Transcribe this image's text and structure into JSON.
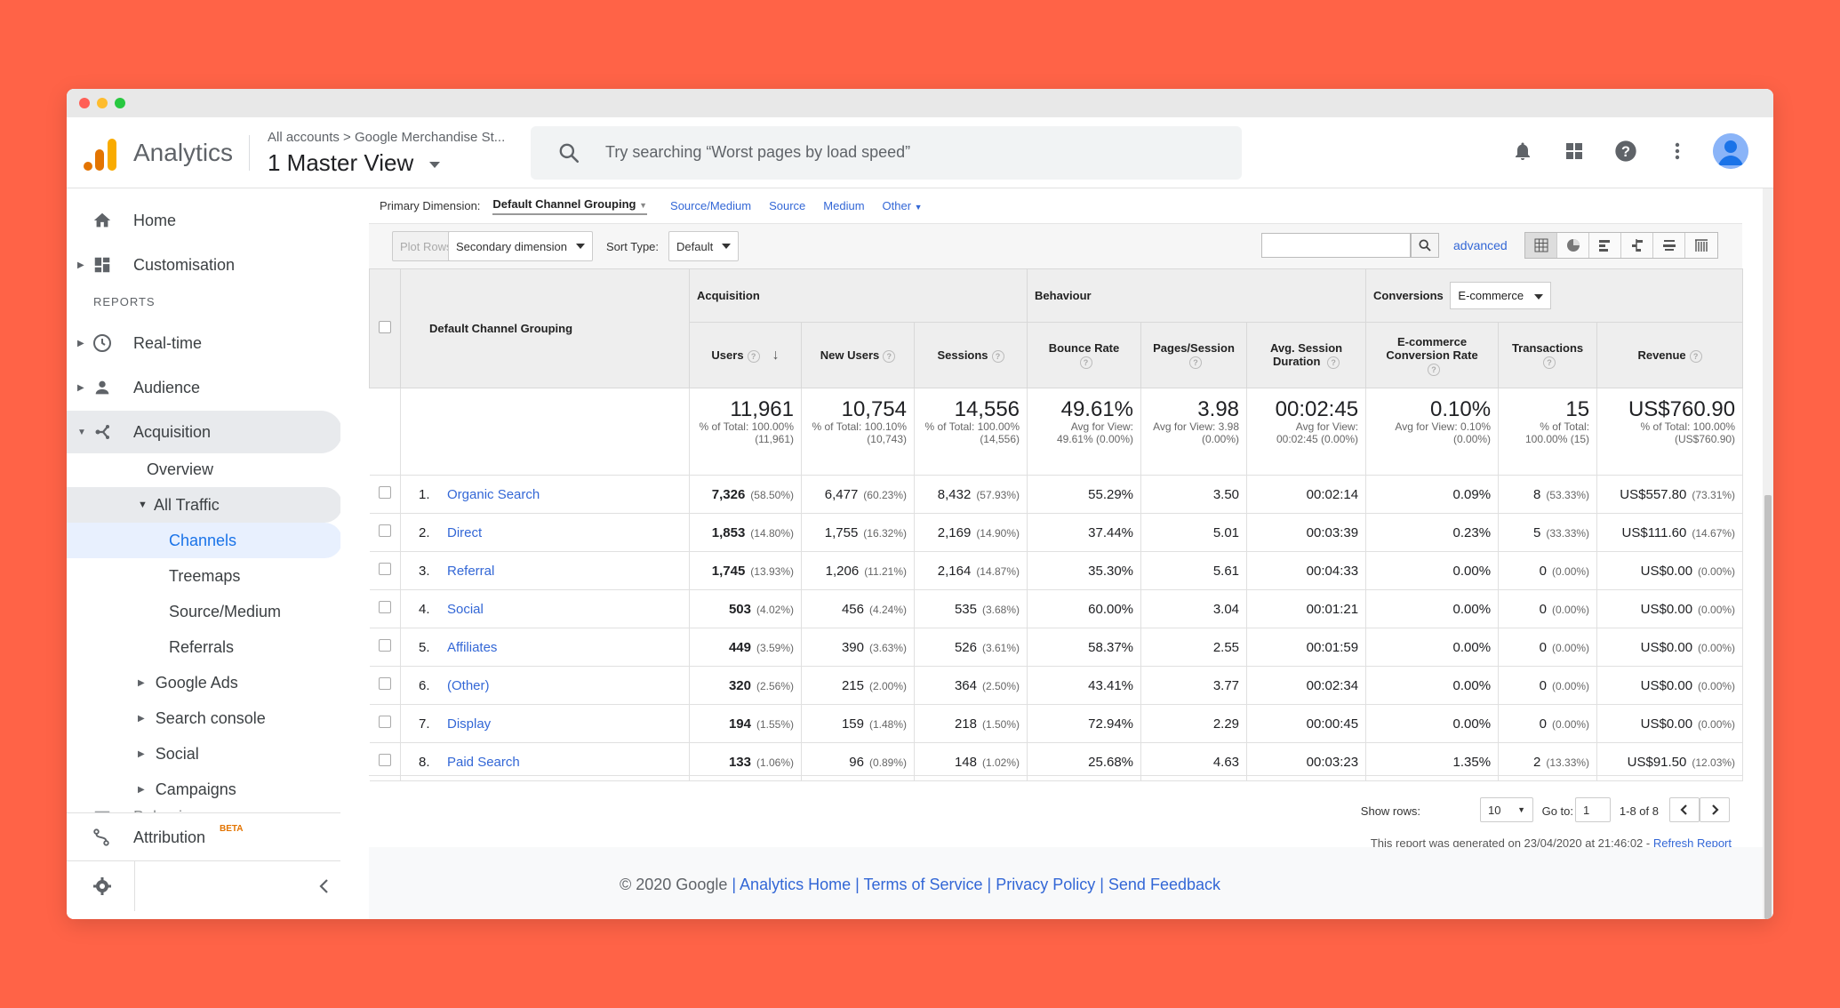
{
  "app": {
    "name": "Analytics"
  },
  "account": {
    "breadcrumb_all": "All accounts",
    "breadcrumb_sep": ">",
    "breadcrumb_property": "Google Merchandise St...",
    "view": "1 Master View"
  },
  "search": {
    "placeholder": "Try searching “Worst pages by load speed”"
  },
  "sidebar": {
    "home": "Home",
    "customisation": "Customisation",
    "reports_heading": "REPORTS",
    "realtime": "Real-time",
    "audience": "Audience",
    "acquisition": "Acquisition",
    "overview": "Overview",
    "all_traffic": "All Traffic",
    "channels": "Channels",
    "treemaps": "Treemaps",
    "source_medium": "Source/Medium",
    "referrals": "Referrals",
    "google_ads": "Google Ads",
    "search_console": "Search console",
    "social": "Social",
    "campaigns": "Campaigns",
    "behaviour": "Behaviour",
    "attribution": "Attribution",
    "beta": "BETA"
  },
  "dimbar": {
    "label": "Primary Dimension:",
    "active": "Default Channel Grouping",
    "options": [
      "Source/Medium",
      "Source",
      "Medium",
      "Other"
    ]
  },
  "toolbar": {
    "plot_rows": "Plot Rows",
    "secondary_dimension": "Secondary dimension",
    "sort_type_label": "Sort Type:",
    "sort_type_value": "Default",
    "advanced": "advanced"
  },
  "table": {
    "dim_header": "Default Channel Grouping",
    "group_acquisition": "Acquisition",
    "group_behaviour": "Behaviour",
    "group_conversions": "Conversions",
    "conversions_select": "E-commerce",
    "columns": [
      "Users",
      "New Users",
      "Sessions",
      "Bounce Rate",
      "Pages/Session",
      "Avg. Session Duration",
      "E-commerce Conversion Rate",
      "Transactions",
      "Revenue"
    ],
    "totals": [
      {
        "big": "11,961",
        "small": "% of Total: 100.00% (11,961)"
      },
      {
        "big": "10,754",
        "small": "% of Total: 100.10% (10,743)"
      },
      {
        "big": "14,556",
        "small": "% of Total: 100.00% (14,556)"
      },
      {
        "big": "49.61%",
        "small": "Avg for View: 49.61% (0.00%)"
      },
      {
        "big": "3.98",
        "small": "Avg for View: 3.98 (0.00%)"
      },
      {
        "big": "00:02:45",
        "small": "Avg for View: 00:02:45 (0.00%)"
      },
      {
        "big": "0.10%",
        "small": "Avg for View: 0.10% (0.00%)"
      },
      {
        "big": "15",
        "small": "% of Total: 100.00% (15)"
      },
      {
        "big": "US$760.90",
        "small": "% of Total: 100.00% (US$760.90)"
      }
    ],
    "rows": [
      {
        "n": "1.",
        "name": "Organic Search",
        "users": "7,326",
        "users_pct": "(58.50%)",
        "new": "6,477",
        "new_pct": "(60.23%)",
        "sess": "8,432",
        "sess_pct": "(57.93%)",
        "bounce": "55.29%",
        "pps": "3.50",
        "dur": "00:02:14",
        "conv": "0.09%",
        "tx": "8",
        "tx_pct": "(53.33%)",
        "rev": "US$557.80",
        "rev_pct": "(73.31%)"
      },
      {
        "n": "2.",
        "name": "Direct",
        "users": "1,853",
        "users_pct": "(14.80%)",
        "new": "1,755",
        "new_pct": "(16.32%)",
        "sess": "2,169",
        "sess_pct": "(14.90%)",
        "bounce": "37.44%",
        "pps": "5.01",
        "dur": "00:03:39",
        "conv": "0.23%",
        "tx": "5",
        "tx_pct": "(33.33%)",
        "rev": "US$111.60",
        "rev_pct": "(14.67%)"
      },
      {
        "n": "3.",
        "name": "Referral",
        "users": "1,745",
        "users_pct": "(13.93%)",
        "new": "1,206",
        "new_pct": "(11.21%)",
        "sess": "2,164",
        "sess_pct": "(14.87%)",
        "bounce": "35.30%",
        "pps": "5.61",
        "dur": "00:04:33",
        "conv": "0.00%",
        "tx": "0",
        "tx_pct": "(0.00%)",
        "rev": "US$0.00",
        "rev_pct": "(0.00%)"
      },
      {
        "n": "4.",
        "name": "Social",
        "users": "503",
        "users_pct": "(4.02%)",
        "new": "456",
        "new_pct": "(4.24%)",
        "sess": "535",
        "sess_pct": "(3.68%)",
        "bounce": "60.00%",
        "pps": "3.04",
        "dur": "00:01:21",
        "conv": "0.00%",
        "tx": "0",
        "tx_pct": "(0.00%)",
        "rev": "US$0.00",
        "rev_pct": "(0.00%)"
      },
      {
        "n": "5.",
        "name": "Affiliates",
        "users": "449",
        "users_pct": "(3.59%)",
        "new": "390",
        "new_pct": "(3.63%)",
        "sess": "526",
        "sess_pct": "(3.61%)",
        "bounce": "58.37%",
        "pps": "2.55",
        "dur": "00:01:59",
        "conv": "0.00%",
        "tx": "0",
        "tx_pct": "(0.00%)",
        "rev": "US$0.00",
        "rev_pct": "(0.00%)"
      },
      {
        "n": "6.",
        "name": "(Other)",
        "users": "320",
        "users_pct": "(2.56%)",
        "new": "215",
        "new_pct": "(2.00%)",
        "sess": "364",
        "sess_pct": "(2.50%)",
        "bounce": "43.41%",
        "pps": "3.77",
        "dur": "00:02:34",
        "conv": "0.00%",
        "tx": "0",
        "tx_pct": "(0.00%)",
        "rev": "US$0.00",
        "rev_pct": "(0.00%)"
      },
      {
        "n": "7.",
        "name": "Display",
        "users": "194",
        "users_pct": "(1.55%)",
        "new": "159",
        "new_pct": "(1.48%)",
        "sess": "218",
        "sess_pct": "(1.50%)",
        "bounce": "72.94%",
        "pps": "2.29",
        "dur": "00:00:45",
        "conv": "0.00%",
        "tx": "0",
        "tx_pct": "(0.00%)",
        "rev": "US$0.00",
        "rev_pct": "(0.00%)"
      },
      {
        "n": "8.",
        "name": "Paid Search",
        "users": "133",
        "users_pct": "(1.06%)",
        "new": "96",
        "new_pct": "(0.89%)",
        "sess": "148",
        "sess_pct": "(1.02%)",
        "bounce": "25.68%",
        "pps": "4.63",
        "dur": "00:03:23",
        "conv": "1.35%",
        "tx": "2",
        "tx_pct": "(13.33%)",
        "rev": "US$91.50",
        "rev_pct": "(12.03%)"
      }
    ]
  },
  "pagination": {
    "show_rows_label": "Show rows:",
    "show_rows_value": "10",
    "goto_label": "Go to:",
    "goto_value": "1",
    "range": "1-8 of 8"
  },
  "report_note": {
    "text": "This report was generated on 23/04/2020 at 21:46:02 - ",
    "refresh": "Refresh Report"
  },
  "footer": {
    "copyright": "© 2020 Google",
    "sep": " | ",
    "links": [
      "Analytics Home",
      "Terms of Service",
      "Privacy Policy",
      "Send Feedback"
    ]
  },
  "colors": {
    "background": "#ff6347",
    "accent": "#3367d6",
    "logo_orange": "#f9ab00",
    "logo_dark": "#e37400"
  }
}
